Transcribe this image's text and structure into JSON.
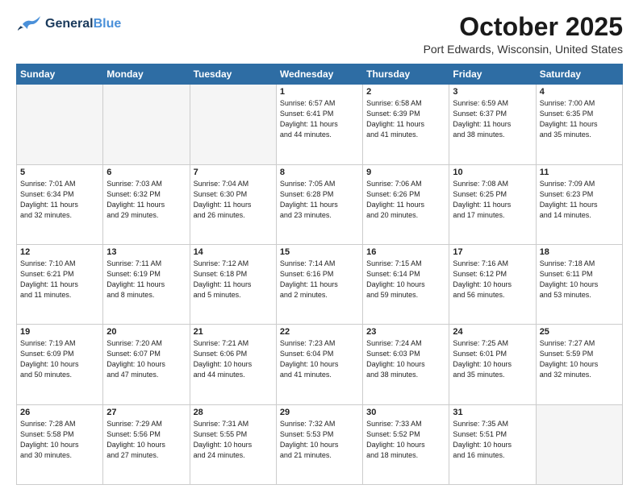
{
  "header": {
    "logo_line1": "General",
    "logo_line2": "Blue",
    "month": "October 2025",
    "location": "Port Edwards, Wisconsin, United States"
  },
  "days_of_week": [
    "Sunday",
    "Monday",
    "Tuesday",
    "Wednesday",
    "Thursday",
    "Friday",
    "Saturday"
  ],
  "weeks": [
    [
      {
        "day": "",
        "info": ""
      },
      {
        "day": "",
        "info": ""
      },
      {
        "day": "",
        "info": ""
      },
      {
        "day": "1",
        "info": "Sunrise: 6:57 AM\nSunset: 6:41 PM\nDaylight: 11 hours\nand 44 minutes."
      },
      {
        "day": "2",
        "info": "Sunrise: 6:58 AM\nSunset: 6:39 PM\nDaylight: 11 hours\nand 41 minutes."
      },
      {
        "day": "3",
        "info": "Sunrise: 6:59 AM\nSunset: 6:37 PM\nDaylight: 11 hours\nand 38 minutes."
      },
      {
        "day": "4",
        "info": "Sunrise: 7:00 AM\nSunset: 6:35 PM\nDaylight: 11 hours\nand 35 minutes."
      }
    ],
    [
      {
        "day": "5",
        "info": "Sunrise: 7:01 AM\nSunset: 6:34 PM\nDaylight: 11 hours\nand 32 minutes."
      },
      {
        "day": "6",
        "info": "Sunrise: 7:03 AM\nSunset: 6:32 PM\nDaylight: 11 hours\nand 29 minutes."
      },
      {
        "day": "7",
        "info": "Sunrise: 7:04 AM\nSunset: 6:30 PM\nDaylight: 11 hours\nand 26 minutes."
      },
      {
        "day": "8",
        "info": "Sunrise: 7:05 AM\nSunset: 6:28 PM\nDaylight: 11 hours\nand 23 minutes."
      },
      {
        "day": "9",
        "info": "Sunrise: 7:06 AM\nSunset: 6:26 PM\nDaylight: 11 hours\nand 20 minutes."
      },
      {
        "day": "10",
        "info": "Sunrise: 7:08 AM\nSunset: 6:25 PM\nDaylight: 11 hours\nand 17 minutes."
      },
      {
        "day": "11",
        "info": "Sunrise: 7:09 AM\nSunset: 6:23 PM\nDaylight: 11 hours\nand 14 minutes."
      }
    ],
    [
      {
        "day": "12",
        "info": "Sunrise: 7:10 AM\nSunset: 6:21 PM\nDaylight: 11 hours\nand 11 minutes."
      },
      {
        "day": "13",
        "info": "Sunrise: 7:11 AM\nSunset: 6:19 PM\nDaylight: 11 hours\nand 8 minutes."
      },
      {
        "day": "14",
        "info": "Sunrise: 7:12 AM\nSunset: 6:18 PM\nDaylight: 11 hours\nand 5 minutes."
      },
      {
        "day": "15",
        "info": "Sunrise: 7:14 AM\nSunset: 6:16 PM\nDaylight: 11 hours\nand 2 minutes."
      },
      {
        "day": "16",
        "info": "Sunrise: 7:15 AM\nSunset: 6:14 PM\nDaylight: 10 hours\nand 59 minutes."
      },
      {
        "day": "17",
        "info": "Sunrise: 7:16 AM\nSunset: 6:12 PM\nDaylight: 10 hours\nand 56 minutes."
      },
      {
        "day": "18",
        "info": "Sunrise: 7:18 AM\nSunset: 6:11 PM\nDaylight: 10 hours\nand 53 minutes."
      }
    ],
    [
      {
        "day": "19",
        "info": "Sunrise: 7:19 AM\nSunset: 6:09 PM\nDaylight: 10 hours\nand 50 minutes."
      },
      {
        "day": "20",
        "info": "Sunrise: 7:20 AM\nSunset: 6:07 PM\nDaylight: 10 hours\nand 47 minutes."
      },
      {
        "day": "21",
        "info": "Sunrise: 7:21 AM\nSunset: 6:06 PM\nDaylight: 10 hours\nand 44 minutes."
      },
      {
        "day": "22",
        "info": "Sunrise: 7:23 AM\nSunset: 6:04 PM\nDaylight: 10 hours\nand 41 minutes."
      },
      {
        "day": "23",
        "info": "Sunrise: 7:24 AM\nSunset: 6:03 PM\nDaylight: 10 hours\nand 38 minutes."
      },
      {
        "day": "24",
        "info": "Sunrise: 7:25 AM\nSunset: 6:01 PM\nDaylight: 10 hours\nand 35 minutes."
      },
      {
        "day": "25",
        "info": "Sunrise: 7:27 AM\nSunset: 5:59 PM\nDaylight: 10 hours\nand 32 minutes."
      }
    ],
    [
      {
        "day": "26",
        "info": "Sunrise: 7:28 AM\nSunset: 5:58 PM\nDaylight: 10 hours\nand 30 minutes."
      },
      {
        "day": "27",
        "info": "Sunrise: 7:29 AM\nSunset: 5:56 PM\nDaylight: 10 hours\nand 27 minutes."
      },
      {
        "day": "28",
        "info": "Sunrise: 7:31 AM\nSunset: 5:55 PM\nDaylight: 10 hours\nand 24 minutes."
      },
      {
        "day": "29",
        "info": "Sunrise: 7:32 AM\nSunset: 5:53 PM\nDaylight: 10 hours\nand 21 minutes."
      },
      {
        "day": "30",
        "info": "Sunrise: 7:33 AM\nSunset: 5:52 PM\nDaylight: 10 hours\nand 18 minutes."
      },
      {
        "day": "31",
        "info": "Sunrise: 7:35 AM\nSunset: 5:51 PM\nDaylight: 10 hours\nand 16 minutes."
      },
      {
        "day": "",
        "info": ""
      }
    ]
  ]
}
